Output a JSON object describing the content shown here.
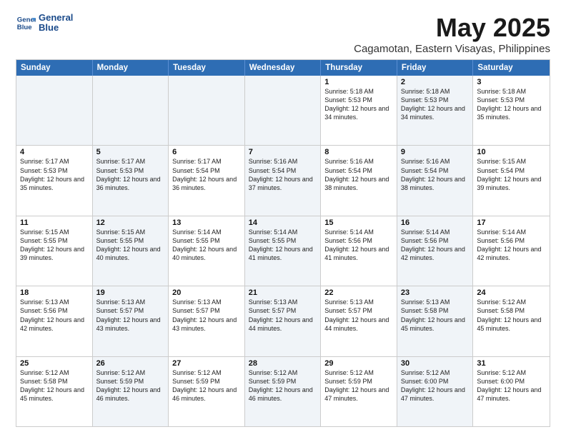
{
  "header": {
    "logo_line1": "General",
    "logo_line2": "Blue",
    "month": "May 2025",
    "location": "Cagamotan, Eastern Visayas, Philippines"
  },
  "days_of_week": [
    "Sunday",
    "Monday",
    "Tuesday",
    "Wednesday",
    "Thursday",
    "Friday",
    "Saturday"
  ],
  "weeks": [
    [
      {
        "day": "",
        "text": "",
        "shaded": true
      },
      {
        "day": "",
        "text": "",
        "shaded": true
      },
      {
        "day": "",
        "text": "",
        "shaded": true
      },
      {
        "day": "",
        "text": "",
        "shaded": true
      },
      {
        "day": "1",
        "text": "Sunrise: 5:18 AM\nSunset: 5:53 PM\nDaylight: 12 hours\nand 34 minutes.",
        "shaded": false
      },
      {
        "day": "2",
        "text": "Sunrise: 5:18 AM\nSunset: 5:53 PM\nDaylight: 12 hours\nand 34 minutes.",
        "shaded": true
      },
      {
        "day": "3",
        "text": "Sunrise: 5:18 AM\nSunset: 5:53 PM\nDaylight: 12 hours\nand 35 minutes.",
        "shaded": false
      }
    ],
    [
      {
        "day": "4",
        "text": "Sunrise: 5:17 AM\nSunset: 5:53 PM\nDaylight: 12 hours\nand 35 minutes.",
        "shaded": false
      },
      {
        "day": "5",
        "text": "Sunrise: 5:17 AM\nSunset: 5:53 PM\nDaylight: 12 hours\nand 36 minutes.",
        "shaded": true
      },
      {
        "day": "6",
        "text": "Sunrise: 5:17 AM\nSunset: 5:54 PM\nDaylight: 12 hours\nand 36 minutes.",
        "shaded": false
      },
      {
        "day": "7",
        "text": "Sunrise: 5:16 AM\nSunset: 5:54 PM\nDaylight: 12 hours\nand 37 minutes.",
        "shaded": true
      },
      {
        "day": "8",
        "text": "Sunrise: 5:16 AM\nSunset: 5:54 PM\nDaylight: 12 hours\nand 38 minutes.",
        "shaded": false
      },
      {
        "day": "9",
        "text": "Sunrise: 5:16 AM\nSunset: 5:54 PM\nDaylight: 12 hours\nand 38 minutes.",
        "shaded": true
      },
      {
        "day": "10",
        "text": "Sunrise: 5:15 AM\nSunset: 5:54 PM\nDaylight: 12 hours\nand 39 minutes.",
        "shaded": false
      }
    ],
    [
      {
        "day": "11",
        "text": "Sunrise: 5:15 AM\nSunset: 5:55 PM\nDaylight: 12 hours\nand 39 minutes.",
        "shaded": false
      },
      {
        "day": "12",
        "text": "Sunrise: 5:15 AM\nSunset: 5:55 PM\nDaylight: 12 hours\nand 40 minutes.",
        "shaded": true
      },
      {
        "day": "13",
        "text": "Sunrise: 5:14 AM\nSunset: 5:55 PM\nDaylight: 12 hours\nand 40 minutes.",
        "shaded": false
      },
      {
        "day": "14",
        "text": "Sunrise: 5:14 AM\nSunset: 5:55 PM\nDaylight: 12 hours\nand 41 minutes.",
        "shaded": true
      },
      {
        "day": "15",
        "text": "Sunrise: 5:14 AM\nSunset: 5:56 PM\nDaylight: 12 hours\nand 41 minutes.",
        "shaded": false
      },
      {
        "day": "16",
        "text": "Sunrise: 5:14 AM\nSunset: 5:56 PM\nDaylight: 12 hours\nand 42 minutes.",
        "shaded": true
      },
      {
        "day": "17",
        "text": "Sunrise: 5:14 AM\nSunset: 5:56 PM\nDaylight: 12 hours\nand 42 minutes.",
        "shaded": false
      }
    ],
    [
      {
        "day": "18",
        "text": "Sunrise: 5:13 AM\nSunset: 5:56 PM\nDaylight: 12 hours\nand 42 minutes.",
        "shaded": false
      },
      {
        "day": "19",
        "text": "Sunrise: 5:13 AM\nSunset: 5:57 PM\nDaylight: 12 hours\nand 43 minutes.",
        "shaded": true
      },
      {
        "day": "20",
        "text": "Sunrise: 5:13 AM\nSunset: 5:57 PM\nDaylight: 12 hours\nand 43 minutes.",
        "shaded": false
      },
      {
        "day": "21",
        "text": "Sunrise: 5:13 AM\nSunset: 5:57 PM\nDaylight: 12 hours\nand 44 minutes.",
        "shaded": true
      },
      {
        "day": "22",
        "text": "Sunrise: 5:13 AM\nSunset: 5:57 PM\nDaylight: 12 hours\nand 44 minutes.",
        "shaded": false
      },
      {
        "day": "23",
        "text": "Sunrise: 5:13 AM\nSunset: 5:58 PM\nDaylight: 12 hours\nand 45 minutes.",
        "shaded": true
      },
      {
        "day": "24",
        "text": "Sunrise: 5:12 AM\nSunset: 5:58 PM\nDaylight: 12 hours\nand 45 minutes.",
        "shaded": false
      }
    ],
    [
      {
        "day": "25",
        "text": "Sunrise: 5:12 AM\nSunset: 5:58 PM\nDaylight: 12 hours\nand 45 minutes.",
        "shaded": false
      },
      {
        "day": "26",
        "text": "Sunrise: 5:12 AM\nSunset: 5:59 PM\nDaylight: 12 hours\nand 46 minutes.",
        "shaded": true
      },
      {
        "day": "27",
        "text": "Sunrise: 5:12 AM\nSunset: 5:59 PM\nDaylight: 12 hours\nand 46 minutes.",
        "shaded": false
      },
      {
        "day": "28",
        "text": "Sunrise: 5:12 AM\nSunset: 5:59 PM\nDaylight: 12 hours\nand 46 minutes.",
        "shaded": true
      },
      {
        "day": "29",
        "text": "Sunrise: 5:12 AM\nSunset: 5:59 PM\nDaylight: 12 hours\nand 47 minutes.",
        "shaded": false
      },
      {
        "day": "30",
        "text": "Sunrise: 5:12 AM\nSunset: 6:00 PM\nDaylight: 12 hours\nand 47 minutes.",
        "shaded": true
      },
      {
        "day": "31",
        "text": "Sunrise: 5:12 AM\nSunset: 6:00 PM\nDaylight: 12 hours\nand 47 minutes.",
        "shaded": false
      }
    ]
  ]
}
